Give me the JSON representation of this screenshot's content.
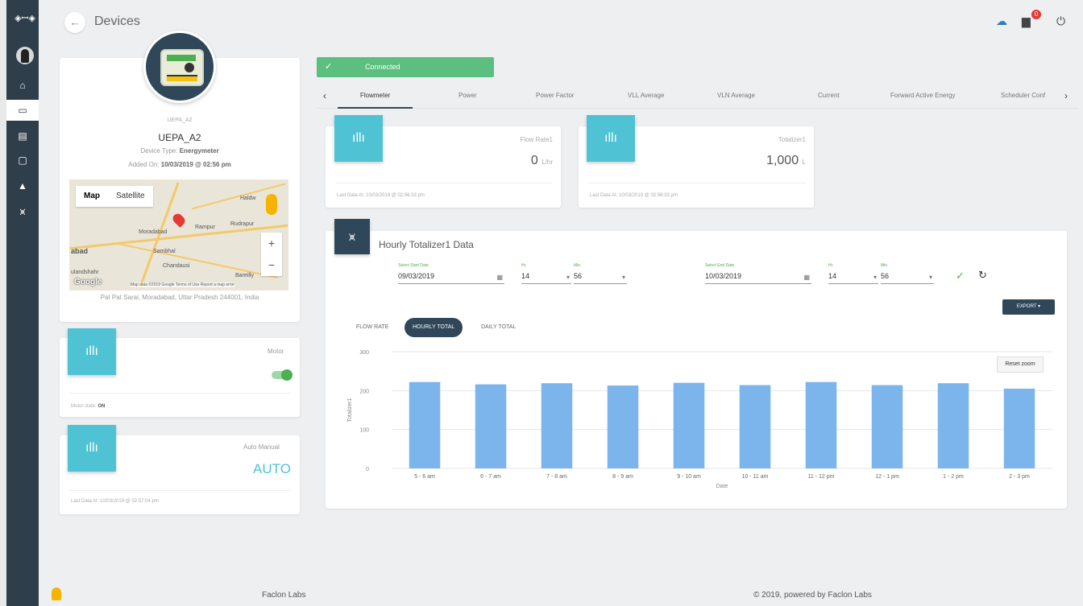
{
  "sidebar": {
    "logo": "◈ꟷ◈",
    "items": [
      {
        "name": "sidebar-item-home",
        "icon": "⌂"
      },
      {
        "name": "sidebar-item-devices",
        "icon": "▭"
      },
      {
        "name": "sidebar-item-inventory",
        "icon": "▤"
      },
      {
        "name": "sidebar-item-messages",
        "icon": "▢"
      },
      {
        "name": "sidebar-item-alerts",
        "icon": "▲"
      },
      {
        "name": "sidebar-item-analytics",
        "icon": "⩙"
      }
    ]
  },
  "header": {
    "back_icon": "←",
    "title": "Devices",
    "notification_count": "0",
    "cloud_icon": "☁",
    "chat_icon": "▆",
    "power_icon": "⏻"
  },
  "device": {
    "small_id": "UEPA_A2",
    "name": "UEPA_A2",
    "type_label": "Device Type:",
    "type_value": "Energymeter",
    "added_label": "Added On:",
    "added_value": "10/03/2019 @ 02:56 pm",
    "address": "Pat Pat Sarai, Moradabad, Uttar Pradesh 244001, India"
  },
  "map": {
    "map_label": "Map",
    "satellite_label": "Satellite",
    "zoom_in": "+",
    "zoom_out": "−",
    "google": "Google",
    "footer": "Map data ©2019 Google  Terms of Use  Report a map error",
    "places": {
      "moradabad": "Moradabad",
      "rampur": "Rampur",
      "sambhal": "Sambhal",
      "chandausi": "Chandausi",
      "bareilly": "Bareilly",
      "haldw": "Haldw",
      "rudrapur": "Rudrapur",
      "abad": "abad",
      "bulandshahr": "ulandshahr"
    }
  },
  "motor": {
    "icon": "ıllı",
    "label": "Motor",
    "status_label": "Motor state:",
    "status_value": "ON"
  },
  "auto_manual": {
    "icon": "ıllı",
    "label": "Auto Manual",
    "value": "AUTO",
    "last_data": "Last Data At: 10/03/2019 @ 02:57:04 pm"
  },
  "connection": {
    "check": "✓",
    "label": "Connected"
  },
  "tabs": {
    "prev": "‹",
    "next": "›",
    "items": [
      "Flowmeter",
      "Power",
      "Power Factor",
      "VLL Average",
      "VLN Average",
      "Current",
      "Forward Active Energy",
      "Scheduler Conf"
    ]
  },
  "flow_rate": {
    "icon": "ıllı",
    "label": "Flow Rate1",
    "value": "0",
    "unit": "L/hr",
    "last_data": "Last Data At: 10/03/2019 @ 02:56:33 pm"
  },
  "totalizer": {
    "icon": "ıllı",
    "label": "Totalizer1",
    "value": "1,000",
    "unit": "L",
    "last_data": "Last Data At: 10/03/2019 @ 02:56:33 pm"
  },
  "hourly": {
    "icon": "⩙",
    "title": "Hourly Totalizer1 Data",
    "start_date_label": "Select Start Date",
    "start_date": "09/03/2019",
    "start_hr_label": "Hr.",
    "start_hr": "14",
    "start_min_label": "Min.",
    "start_min": "56",
    "end_date_label": "Select End Date",
    "end_date": "10/03/2019",
    "end_hr_label": "Hr.",
    "end_hr": "14",
    "end_min_label": "Min.",
    "end_min": "56",
    "calendar_icon": "▦",
    "dropdown_icon": "▾",
    "confirm_icon": "✓",
    "refresh_icon": "↻",
    "export_label": "EXPORT ▾",
    "tab_flow": "FLOW RATE",
    "tab_hourly": "HOURLY TOTAL",
    "tab_daily": "DAILY TOTAL",
    "reset_zoom": "Reset zoom"
  },
  "chart_data": {
    "type": "bar",
    "categories": [
      "5 - 6 am",
      "6 - 7 am",
      "7 - 8 am",
      "8 - 9 am",
      "9 - 10 am",
      "10 - 11 am",
      "11 - 12 pm",
      "12 - 1 pm",
      "1 - 2 pm",
      "2 - 3 pm"
    ],
    "values": [
      222,
      216,
      219,
      213,
      220,
      214,
      222,
      214,
      219,
      205
    ],
    "title": "",
    "xlabel": "Date",
    "ylabel": "Totalizer1",
    "ylim": [
      0,
      300
    ],
    "yticks": [
      0,
      100,
      200,
      300
    ],
    "bar_color": "#7cb5ec",
    "grid": true
  },
  "footer": {
    "brand": "Faclon Labs",
    "copyright": "© 2019, powered by Faclon Labs"
  }
}
